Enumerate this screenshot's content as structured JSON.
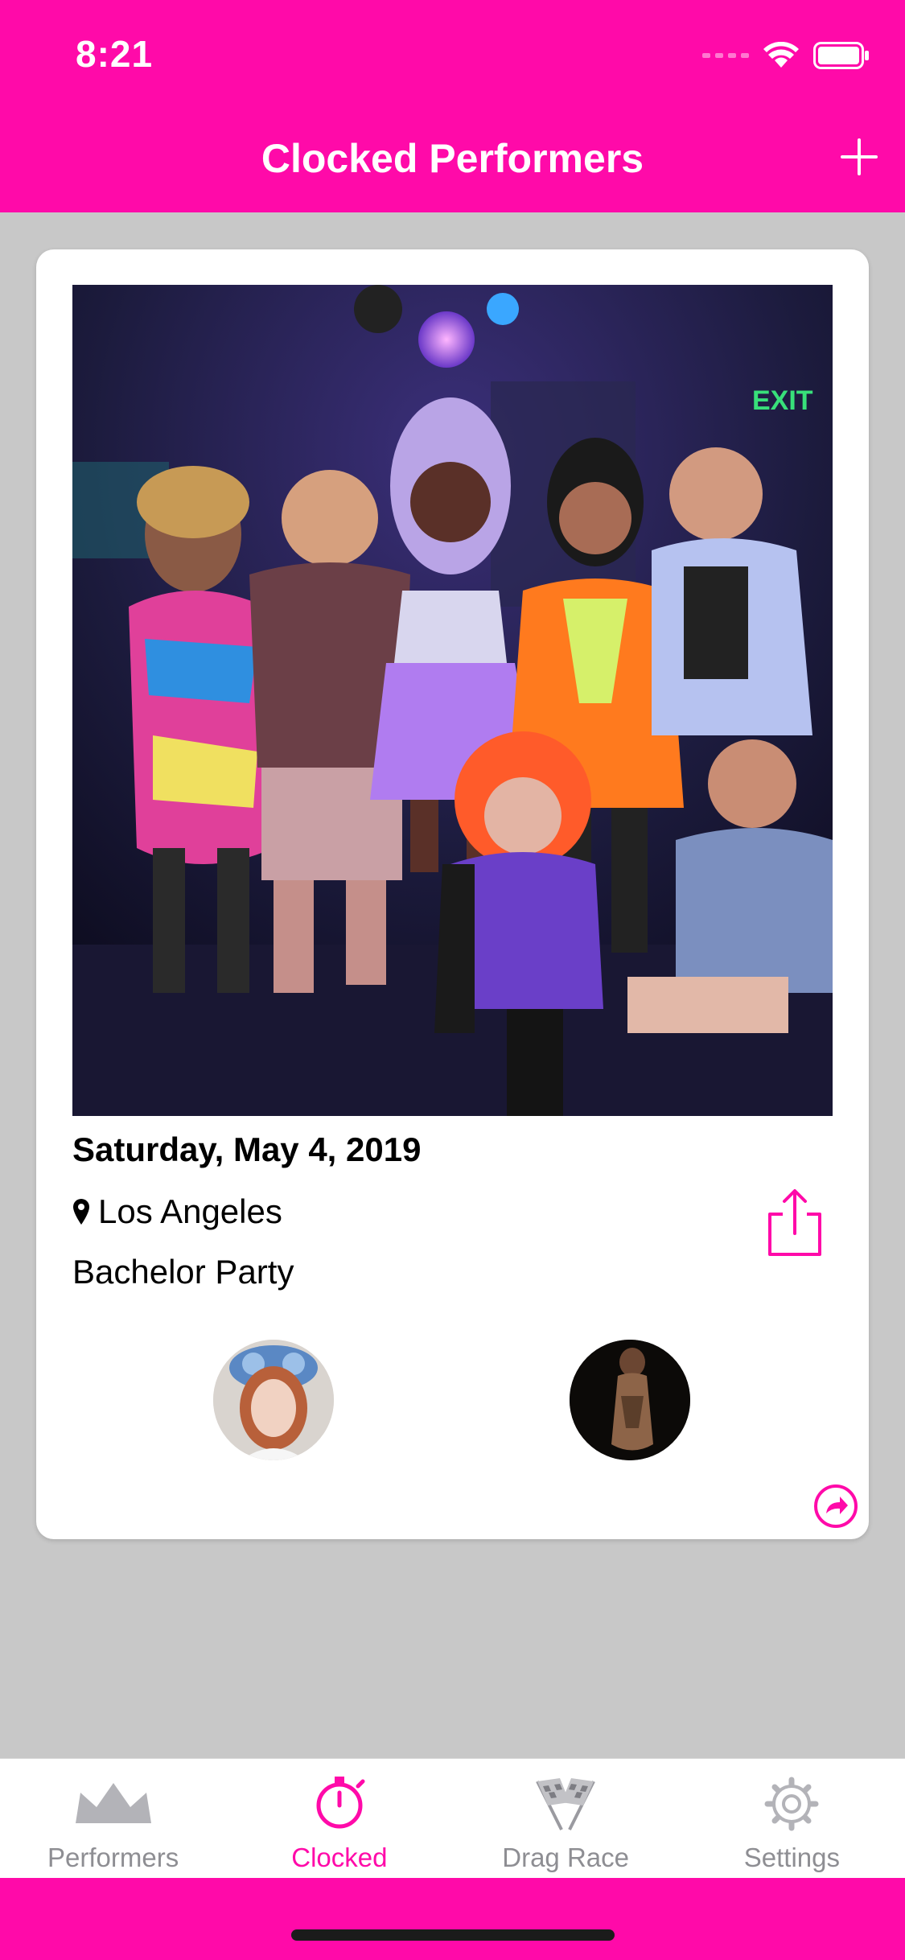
{
  "status_bar": {
    "time": "8:21"
  },
  "nav": {
    "title": "Clocked Performers",
    "add_icon": "plus-icon"
  },
  "card": {
    "date": "Saturday, May 4, 2019",
    "location": "Los Angeles",
    "event": "Bachelor Party",
    "location_icon": "map-pin-icon",
    "share_icon": "share-icon",
    "forward_icon": "forward-arrow-icon",
    "photo_sign_text": "EXIT"
  },
  "tabs": [
    {
      "label": "Performers",
      "icon": "crown-icon",
      "active": false
    },
    {
      "label": "Clocked",
      "icon": "stopwatch-icon",
      "active": true
    },
    {
      "label": "Drag Race",
      "icon": "checkered-flags-icon",
      "active": false
    },
    {
      "label": "Settings",
      "icon": "gear-icon",
      "active": false
    }
  ],
  "colors": {
    "accent": "#ff0aa9",
    "background": "#c8c8c8",
    "tab_inactive": "#8e8e93"
  }
}
